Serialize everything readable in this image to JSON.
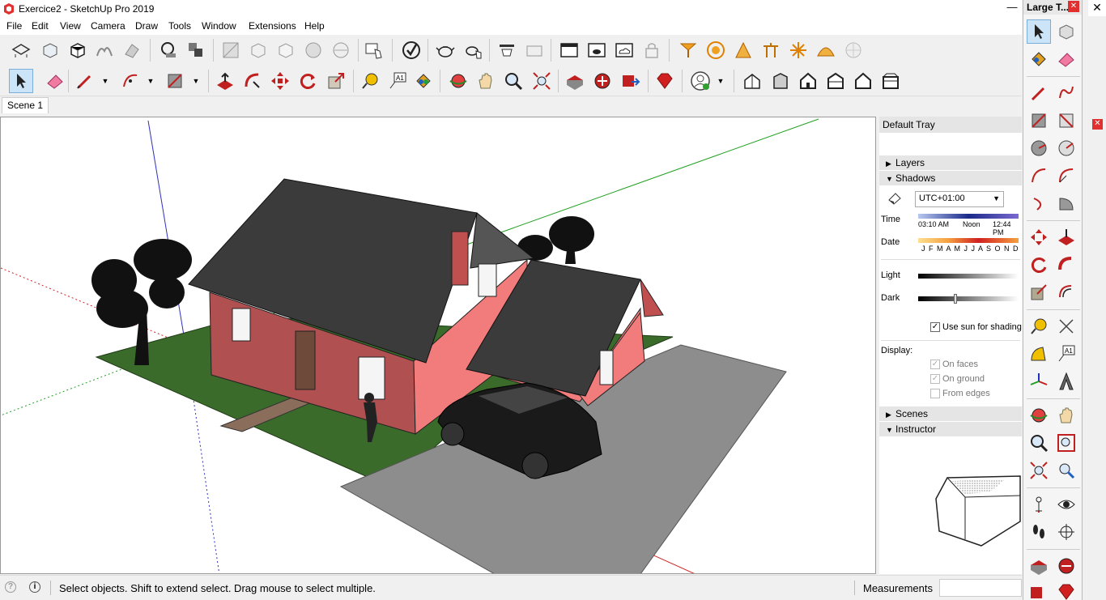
{
  "window": {
    "title": "Exercice2 - SketchUp Pro 2019",
    "minimize_glyph": "—",
    "close_glyph": "✕"
  },
  "menu": [
    "File",
    "Edit",
    "View",
    "Camera",
    "Draw",
    "Tools",
    "Window",
    "Extensions",
    "Help"
  ],
  "scene_tab": "Scene 1",
  "tray": {
    "title": "Default Tray",
    "sections": {
      "layers": "Layers",
      "shadows": "Shadows",
      "scenes": "Scenes",
      "instructor": "Instructor"
    },
    "shadows": {
      "timezone": "UTC+01:00",
      "time_label": "Time",
      "time_start": "03:10 AM",
      "time_noon": "Noon",
      "time_end": "12:44 PM",
      "date_label": "Date",
      "months": "J F M A M J J A S O N D",
      "light_label": "Light",
      "dark_label": "Dark",
      "use_sun": "Use sun for shading",
      "display_label": "Display:",
      "on_faces": "On faces",
      "on_ground": "On ground",
      "from_edges": "From edges"
    }
  },
  "large_tools": {
    "title": "Large T...",
    "close_glyph": "✕"
  },
  "status": {
    "text": "Select objects. Shift to extend select. Drag mouse to select multiple.",
    "measurements_label": "Measurements",
    "info_glyph": "i"
  },
  "colors": {
    "accent_red": "#e03030",
    "selection_blue": "#cce4f7",
    "roof": "#3b3b3b",
    "wall": "#f07a7a",
    "grass": "#3a6b2a"
  }
}
